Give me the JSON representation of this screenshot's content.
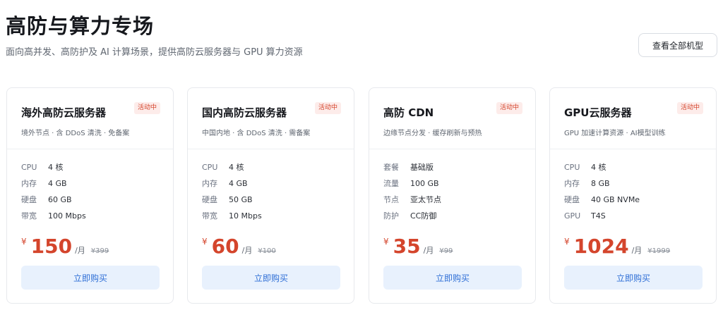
{
  "header": {
    "title": "高防与算力专场",
    "subtitle": "面向高并发、高防护及 AI 计算场景，提供高防云服务器与 GPU 算力资源",
    "view_all_label": "查看全部机型"
  },
  "colors": {
    "accent": "#d4452c",
    "button_bg": "#e8f1fd",
    "button_text": "#2f6fd6"
  },
  "cards": [
    {
      "title": "海外高防云服务器",
      "badge": "活动中",
      "desc": "境外节点 · 含 DDoS 清洗 · 免备案",
      "specs": [
        {
          "k": "CPU",
          "v": "4 核"
        },
        {
          "k": "内存",
          "v": "4 GB"
        },
        {
          "k": "硬盘",
          "v": "60 GB"
        },
        {
          "k": "带宽",
          "v": "100 Mbps"
        }
      ],
      "currency": "¥",
      "price": "150",
      "unit": "/月",
      "original": "¥399",
      "buy_label": "立即购买"
    },
    {
      "title": "国内高防云服务器",
      "badge": "活动中",
      "desc": "中国内地 · 含 DDoS 清洗 · 需备案",
      "specs": [
        {
          "k": "CPU",
          "v": "4 核"
        },
        {
          "k": "内存",
          "v": "4 GB"
        },
        {
          "k": "硬盘",
          "v": "50 GB"
        },
        {
          "k": "带宽",
          "v": "10 Mbps"
        }
      ],
      "currency": "¥",
      "price": "60",
      "unit": "/月",
      "original": "¥100",
      "buy_label": "立即购买"
    },
    {
      "title": "高防 CDN",
      "badge": "活动中",
      "desc": "边缘节点分发 · 缓存刷新与预热",
      "specs": [
        {
          "k": "套餐",
          "v": "基础版"
        },
        {
          "k": "流量",
          "v": "100 GB"
        },
        {
          "k": "节点",
          "v": "亚太节点"
        },
        {
          "k": "防护",
          "v": "CC防御"
        }
      ],
      "currency": "¥",
      "price": "35",
      "unit": "/月",
      "original": "¥99",
      "buy_label": "立即购买"
    },
    {
      "title": "GPU云服务器",
      "badge": "活动中",
      "desc": "GPU 加速计算资源 · AI模型训练",
      "specs": [
        {
          "k": "CPU",
          "v": "4 核"
        },
        {
          "k": "内存",
          "v": "8 GB"
        },
        {
          "k": "硬盘",
          "v": "40 GB NVMe"
        },
        {
          "k": "GPU",
          "v": "T4S"
        }
      ],
      "currency": "¥",
      "price": "1024",
      "unit": "/月",
      "original": "¥1999",
      "buy_label": "立即购买"
    }
  ]
}
